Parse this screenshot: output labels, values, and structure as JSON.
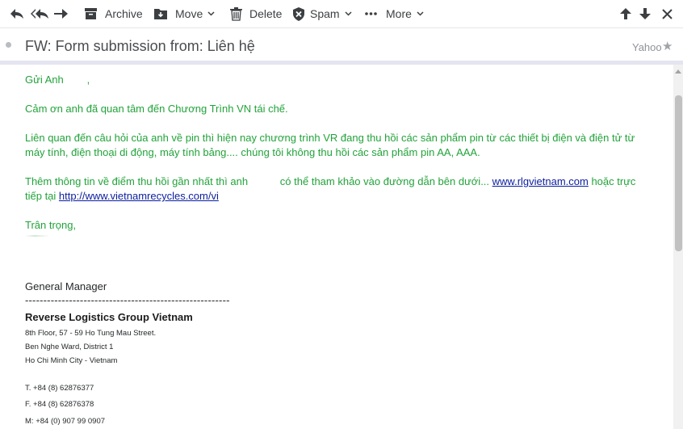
{
  "toolbar": {
    "reply_icon": "reply-icon",
    "reply_all_icon": "reply-all-icon",
    "forward_icon": "forward-icon",
    "archive_label": "Archive",
    "move_label": "Move",
    "delete_label": "Delete",
    "spam_label": "Spam",
    "more_label": "More",
    "prev_icon": "arrow-up-icon",
    "next_icon": "arrow-down-icon",
    "close_icon": "close-icon"
  },
  "message": {
    "subject": "FW: Form submission from: Liên hệ",
    "provider": "Yahoo",
    "greeting": "Gửi Anh        ,",
    "thanks": "Cảm ơn anh đã quan tâm đến Chương Trình VN tái chế.",
    "para_battery": "Liên quan đến câu hỏi của anh về pin thì hiện nay chương trình VR đang thu hồi các sản phẩm pin từ các thiết bị điện và điện tử từ máy tính, điện thoại di động, máy tính bảng.... chúng tôi không thu hồi các sản phẩm pin AA, AAA.",
    "para_info_start": "Thêm thông tin về điểm thu hồi gần nhất thì anh           có thể tham khảo vào đường dẫn bên dưới... ",
    "link1": "www.rlgvietnam.com",
    "para_info_mid": " hoặc trực tiếp tại ",
    "link2": "http://www.vietnamrecycles.com/vi",
    "closing": "Trân trọng,"
  },
  "signature": {
    "title": "General Manager",
    "divider": "--------------------------------------------------------",
    "company": "Reverse Logistics Group Vietnam",
    "address1": "8th Floor, 57 - 59 Ho Tung Mau Street.",
    "address2": "Ben Nghe Ward, District 1",
    "address3": "Ho Chi Minh City - Vietnam",
    "tel": "T. +84 (8) 62876377",
    "fax": "F. +84 (8) 62876378",
    "mobile": "M: +84 (0) 907 99 0907"
  },
  "colors": {
    "body_text": "#22a33a",
    "link": "#0b1e9e",
    "toolbar_icon": "#3c3f42"
  }
}
